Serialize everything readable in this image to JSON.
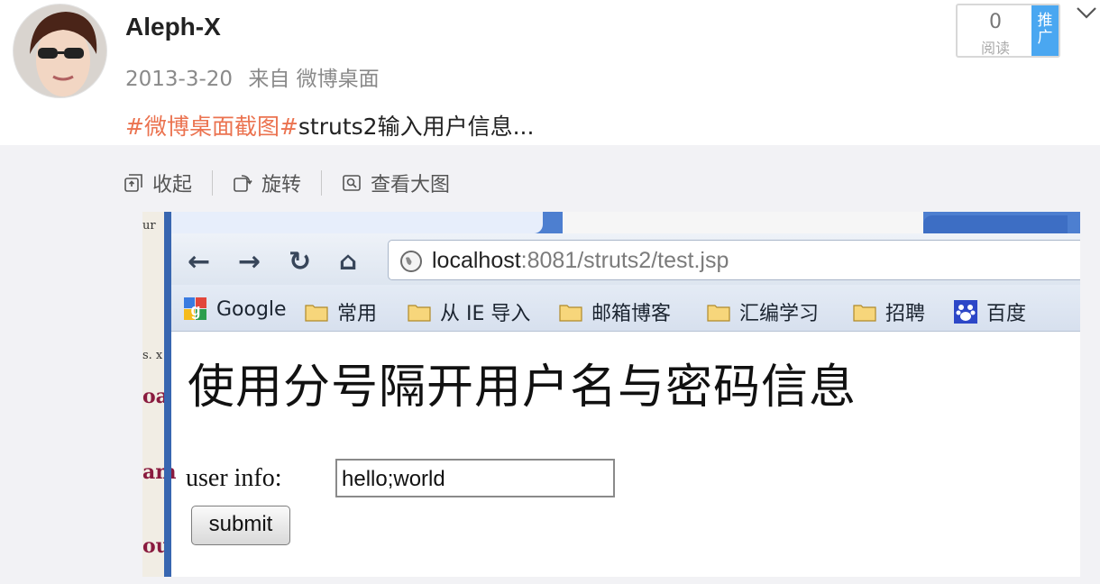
{
  "post": {
    "author": "Aleph-X",
    "date": "2013-3-20",
    "source": "来自 微博桌面",
    "hashtag": "#微博桌面截图#",
    "text": "struts2输入用户信息..."
  },
  "read_box": {
    "count": "0",
    "label": "阅读",
    "promote": "推广"
  },
  "image_actions": [
    {
      "label": "收起",
      "icon": "collapse-icon"
    },
    {
      "label": "旋转",
      "icon": "rotate-icon"
    },
    {
      "label": "查看大图",
      "icon": "view-large-icon"
    }
  ],
  "screenshot": {
    "url_host": "localhost",
    "url_rest": ":8081/struts2/test.jsp",
    "bookmarks": [
      {
        "label": "Google",
        "icon": "google-icon"
      },
      {
        "label": "常用",
        "icon": "folder-icon"
      },
      {
        "label": "从 IE 导入",
        "icon": "folder-icon"
      },
      {
        "label": "邮箱博客",
        "icon": "folder-icon"
      },
      {
        "label": "汇编学习",
        "icon": "folder-icon"
      },
      {
        "label": "招聘",
        "icon": "folder-icon"
      },
      {
        "label": "百度",
        "icon": "baidu-icon"
      }
    ],
    "page_heading": "使用分号隔开用户名与密码信息",
    "form_label": "user info:",
    "form_value": "hello;world",
    "submit_label": "submit",
    "side_fragments": [
      "ur",
      "s. x",
      "oa",
      "am",
      "ou"
    ]
  },
  "colors": {
    "tag": "#eb7350",
    "promote": "#4aa7f1",
    "panel": "#f2f2f5"
  }
}
